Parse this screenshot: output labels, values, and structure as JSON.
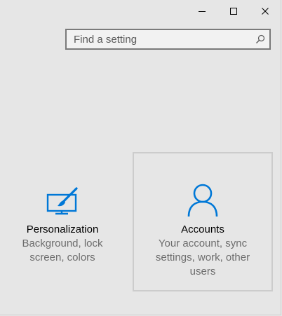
{
  "window": {
    "caption_buttons": [
      "minimize",
      "maximize",
      "close"
    ]
  },
  "search": {
    "placeholder": "Find a setting",
    "icon": "search-icon"
  },
  "tiles": [
    {
      "id": "personalization",
      "title": "Personalization",
      "description": "Background, lock screen, colors",
      "icon": "personalization-icon"
    },
    {
      "id": "accounts",
      "title": "Accounts",
      "description": "Your account, sync settings, work, other users",
      "icon": "accounts-icon"
    }
  ],
  "colors": {
    "accent": "#0078d7",
    "background": "#e6e6e6",
    "text_secondary": "#6d6d6d",
    "tile_border": "#cccccc"
  }
}
